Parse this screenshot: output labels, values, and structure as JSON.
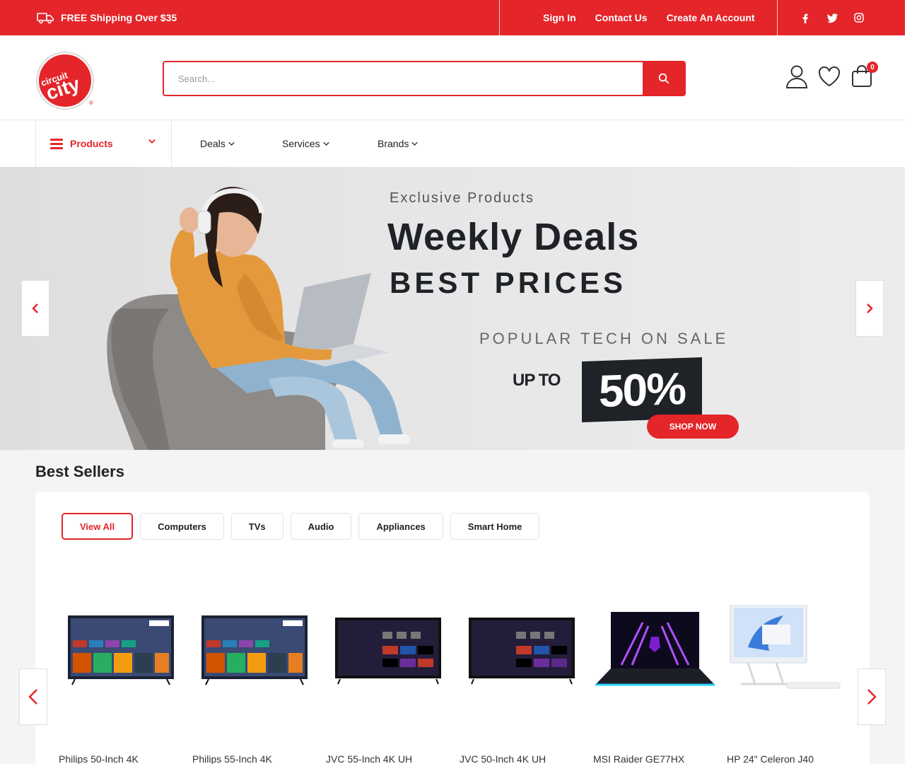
{
  "topbar": {
    "shipping_text": "FREE Shipping Over $35",
    "links": [
      "Sign In",
      "Contact Us",
      "Create An Account"
    ]
  },
  "header": {
    "logo_text": "circuit city",
    "search_placeholder": "Search...",
    "cart_count": "0"
  },
  "nav": {
    "products_label": "Products",
    "items": [
      "Deals",
      "Services",
      "Brands"
    ]
  },
  "hero": {
    "eyebrow": "Exclusive Products",
    "headline": "Weekly Deals",
    "subheadline": "BEST PRICES",
    "tagline": "POPULAR TECH ON SALE",
    "up_to": "UP TO",
    "percent": "50%",
    "cta": "SHOP NOW"
  },
  "best_sellers": {
    "title": "Best Sellers",
    "filters": [
      "View All",
      "Computers",
      "TVs",
      "Audio",
      "Appliances",
      "Smart Home"
    ],
    "active_filter": "View All",
    "products": [
      {
        "name": "Philips 50-Inch 4K",
        "kind": "tv-philips"
      },
      {
        "name": "Philips 55-Inch 4K",
        "kind": "tv-philips"
      },
      {
        "name": "JVC 55-Inch 4K UH",
        "kind": "tv-roku"
      },
      {
        "name": "JVC 50-Inch 4K UH",
        "kind": "tv-roku"
      },
      {
        "name": "MSI Raider GE77HX",
        "kind": "laptop"
      },
      {
        "name": "HP 24\" Celeron J40",
        "kind": "desktop"
      }
    ]
  },
  "colors": {
    "brand_red": "#e4252a",
    "dark": "#1f2226"
  }
}
